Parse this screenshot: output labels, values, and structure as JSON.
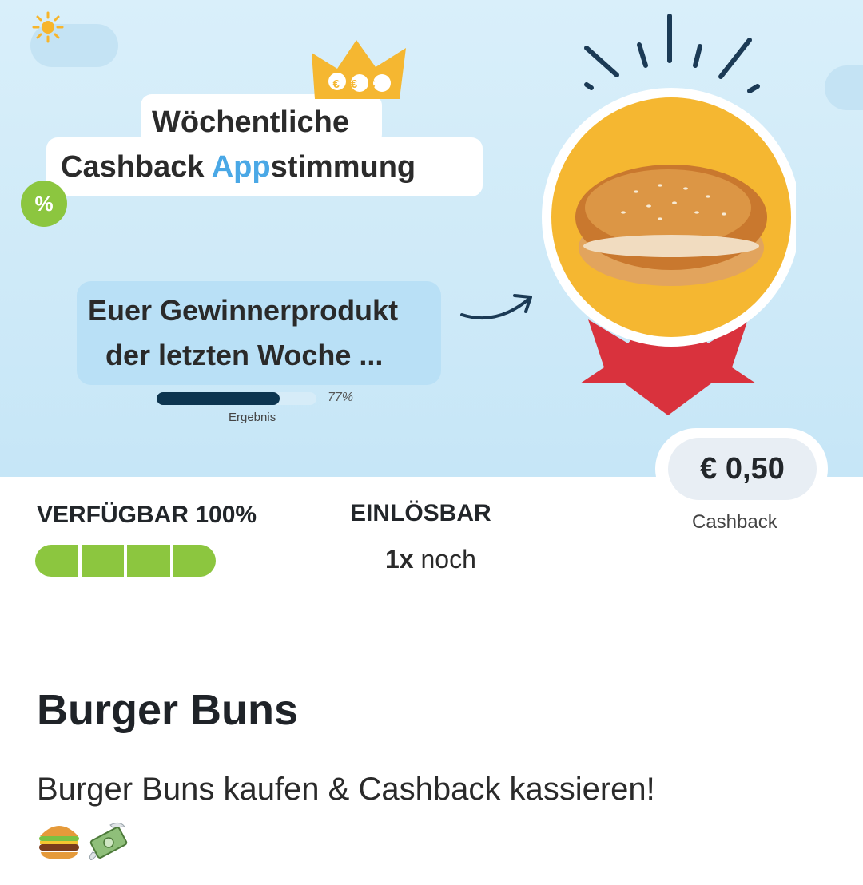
{
  "banner": {
    "headline_line1": "Wöchentliche",
    "headline_line2_pre": "Cashback ",
    "headline_line2_accent": "App",
    "headline_line2_post": "stimmung",
    "crown_text": "€€€",
    "percent_badge": "%",
    "winner_line1": "Euer Gewinnerprodukt",
    "winner_line2": "der letzten Woche ...",
    "result_percent": "77%",
    "result_fraction": 0.77,
    "result_label": "Ergebnis",
    "colors": {
      "accent": "#4aa8e6",
      "medal": "#f5b731",
      "ribbon": "#d9323d",
      "badge": "#8cc63f"
    }
  },
  "price": {
    "amount": "€ 0,50",
    "label": "Cashback"
  },
  "stats": {
    "available_label": "VERFÜGBAR 100%",
    "available_fraction": 1.0,
    "available_segments": 4,
    "redeemable_label": "EINLÖSBAR",
    "redeemable_count": "1x",
    "redeemable_suffix": " noch"
  },
  "product": {
    "title": "Burger Buns",
    "description": "Burger Buns kaufen & Cashback kassieren!",
    "emojis": [
      "hamburger-icon",
      "money-with-wings-icon"
    ]
  }
}
